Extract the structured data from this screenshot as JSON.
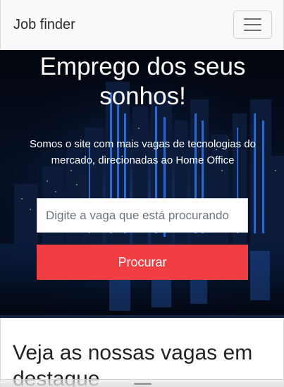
{
  "navbar": {
    "brand": "Job finder",
    "toggle_icon": "hamburger-menu-icon"
  },
  "hero": {
    "title": "Emprego dos seus sonhos!",
    "subtitle": "Somos o site com mais vagas de tecnologias do mercado, direcionadas ao Home Office",
    "background": "night-city-skyline",
    "search": {
      "placeholder": "Digite a vaga que está procurando",
      "value": ""
    },
    "search_button_label": "Procurar"
  },
  "featured": {
    "title": "Veja as nossas vagas em destaque"
  },
  "colors": {
    "navbar_bg": "#f8f9fa",
    "hero_bg": "#040914",
    "button_bg": "#f03e43",
    "text_dark": "#222222"
  }
}
